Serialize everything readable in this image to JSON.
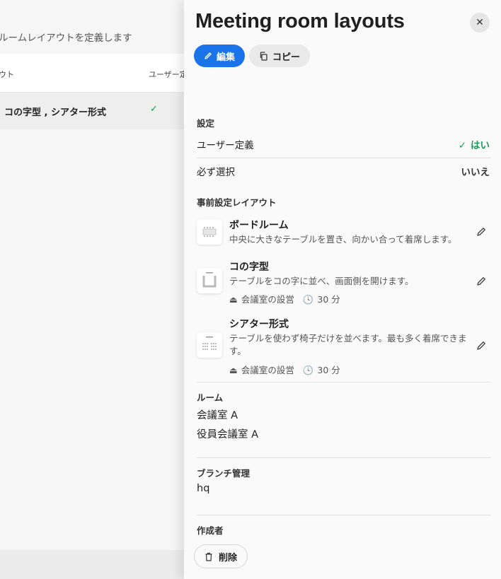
{
  "background": {
    "description": "ルームレイアウトを定義します",
    "table": {
      "col1_header": "ウト",
      "col2_header": "ユーザー定",
      "row": {
        "name": "コの字型 , シアター形式",
        "user_defined_mark": "✓"
      }
    }
  },
  "drawer": {
    "title": "Meeting room layouts",
    "close_label": "✕",
    "edit_label": "編集",
    "copy_label": "コピー",
    "settings": {
      "heading": "設定",
      "user_defined": {
        "label": "ユーザー定義",
        "value": "はい",
        "mark": "✓"
      },
      "required": {
        "label": "必ず選択",
        "value": "いいえ"
      }
    },
    "preset_layouts": {
      "heading": "事前設定レイアウト",
      "items": [
        {
          "title": "ボードルーム",
          "description": "中央に大きなテーブルを置き、向かい合って着席します。",
          "meta": null
        },
        {
          "title": "コの字型",
          "description": "テーブルをコの字に並べ、画面側を開けます。",
          "meta": {
            "setup": "会議室の設営",
            "duration": "30 分"
          }
        },
        {
          "title": "シアター形式",
          "description": "テーブルを使わず椅子だけを並べます。最も多く着席できます。",
          "meta": {
            "setup": "会議室の設営",
            "duration": "30 分"
          }
        }
      ]
    },
    "rooms": {
      "label": "ルーム",
      "values": [
        "会議室 A",
        "役員会議室 A"
      ]
    },
    "branch": {
      "label": "ブランチ管理",
      "value": "hq"
    },
    "creator": {
      "label": "作成者"
    },
    "delete_label": "削除",
    "accent_color": "#1a73e8",
    "ok_color": "#1a9a5a"
  }
}
